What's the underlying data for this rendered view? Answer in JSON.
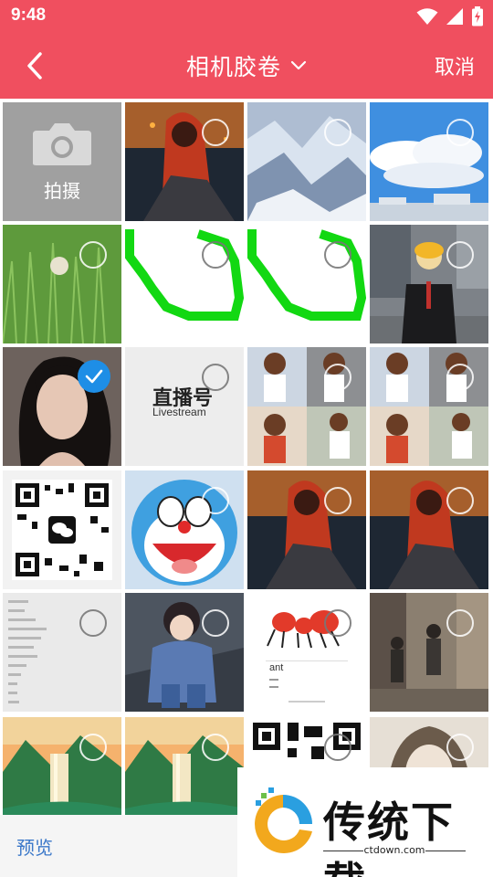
{
  "status_bar": {
    "time": "9:48"
  },
  "header": {
    "title": "相机胶卷",
    "cancel_label": "取消"
  },
  "camera_tile": {
    "label": "拍摄"
  },
  "photos": [
    {
      "icon": "camera-icon"
    }
  ],
  "tile_texts": {
    "livestream_brand": "直播号",
    "livestream_sub": "Livestream",
    "ant_word": "ant"
  },
  "bottom_bar": {
    "preview_label": "预览"
  },
  "watermark": {
    "brand": "传统下载",
    "url": "ctdown.com"
  },
  "colors": {
    "header_bg": "#f04f5f",
    "check_blue": "#1e8ee6",
    "preview_text": "#3b78c9"
  }
}
